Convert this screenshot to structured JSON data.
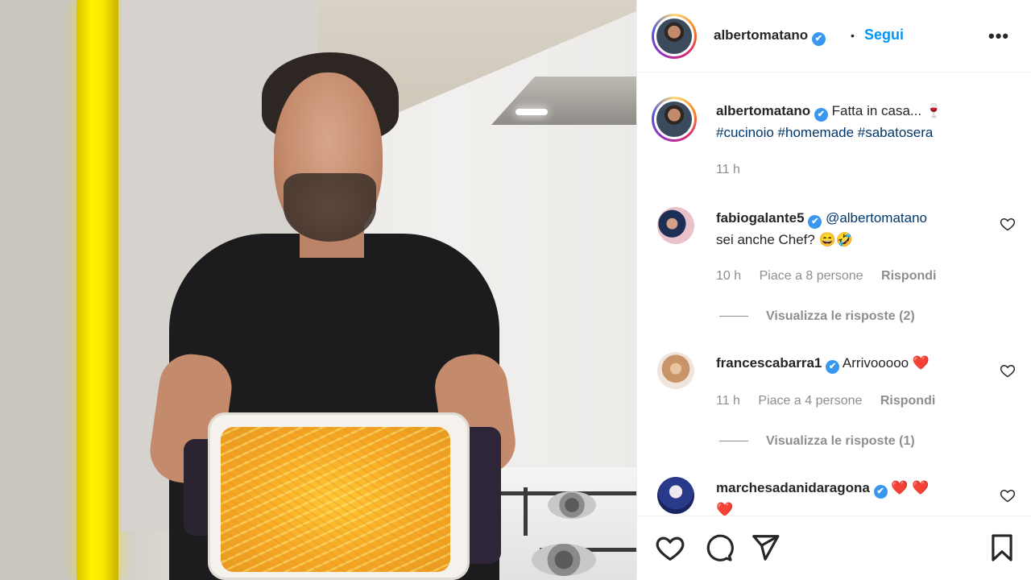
{
  "post": {
    "author": "albertomatano",
    "follow_label": "Segui",
    "more_label": "•••",
    "verified_mark": "✔",
    "separator": "•"
  },
  "caption": {
    "username": "albertomatano",
    "text": "Fatta in casa... 🍷",
    "hashtags": "#cucinoio #homemade #sabatosera",
    "time": "11 h"
  },
  "comments": [
    {
      "username": "fabiogalante5",
      "mention": "@albertomatano",
      "text": "sei anche Chef? 😄🤣",
      "time": "10 h",
      "likes": "Piace a 8 persone",
      "reply_label": "Rispondi",
      "view_replies": "Visualizza le risposte (2)"
    },
    {
      "username": "francescabarra1",
      "text": "Arrivooooo ❤️",
      "time": "11 h",
      "likes": "Piace a 4 persone",
      "reply_label": "Rispondi",
      "view_replies": "Visualizza le risposte (1)"
    },
    {
      "username": "marchesadanidaragona",
      "text": "❤️ ❤️",
      "text_overflow": "❤️"
    }
  ],
  "icons": {
    "like": "heart-icon",
    "comment": "comment-icon",
    "share": "paper-plane-icon",
    "save": "bookmark-icon",
    "more": "more-options-icon"
  },
  "colors": {
    "link_blue": "#0095f6",
    "hashtag": "#00376b",
    "verified": "#3897f0",
    "muted": "#8e8e8e",
    "text": "#262626",
    "heart_red": "#ed4956"
  }
}
